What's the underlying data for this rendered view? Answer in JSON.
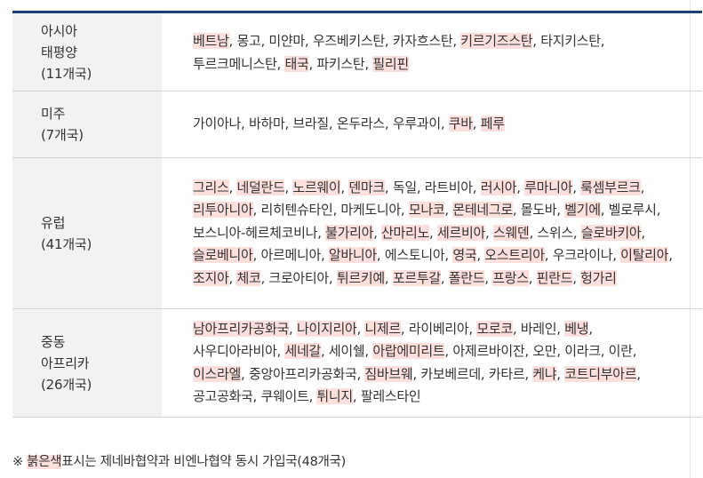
{
  "regions": [
    {
      "name_line1": "아시아",
      "name_line2": "태평양",
      "count": "(11개국)",
      "countries": [
        {
          "name": "베트남",
          "hl": true
        },
        {
          "name": "몽고",
          "hl": false
        },
        {
          "name": "미얀마",
          "hl": false
        },
        {
          "name": "우즈베키스탄",
          "hl": false
        },
        {
          "name": "카자흐스탄",
          "hl": false
        },
        {
          "name": "키르기즈스탄",
          "hl": true
        },
        {
          "name": "타지키스탄",
          "hl": false
        },
        {
          "name": "투르크메니스탄",
          "hl": false
        },
        {
          "name": "태국",
          "hl": true
        },
        {
          "name": "파키스탄",
          "hl": false
        },
        {
          "name": "필리핀",
          "hl": true
        }
      ]
    },
    {
      "name_line1": "미주",
      "name_line2": "",
      "count": "(7개국)",
      "countries": [
        {
          "name": "가이아나",
          "hl": false
        },
        {
          "name": "바하마",
          "hl": false
        },
        {
          "name": "브라질",
          "hl": false
        },
        {
          "name": "온두라스",
          "hl": false
        },
        {
          "name": "우루과이",
          "hl": false
        },
        {
          "name": "쿠바",
          "hl": true
        },
        {
          "name": "페루",
          "hl": true
        }
      ]
    },
    {
      "name_line1": "유럽",
      "name_line2": "",
      "count": "(41개국)",
      "countries": [
        {
          "name": "그리스",
          "hl": true
        },
        {
          "name": "네덜란드",
          "hl": true
        },
        {
          "name": "노르웨이",
          "hl": true
        },
        {
          "name": "덴마크",
          "hl": true
        },
        {
          "name": "독일",
          "hl": false
        },
        {
          "name": "라트비아",
          "hl": false
        },
        {
          "name": "러시아",
          "hl": true
        },
        {
          "name": "루마니아",
          "hl": true
        },
        {
          "name": "룩셈부르크",
          "hl": true
        },
        {
          "name": "리투아니아",
          "hl": true
        },
        {
          "name": "리히텐슈타인",
          "hl": false
        },
        {
          "name": "마케도니아",
          "hl": false
        },
        {
          "name": "모나코",
          "hl": true
        },
        {
          "name": "몬테네그로",
          "hl": true
        },
        {
          "name": "몰도바",
          "hl": false
        },
        {
          "name": "벨기에",
          "hl": true
        },
        {
          "name": "벨로루시",
          "hl": false
        },
        {
          "name": "보스니아-헤르체코비나",
          "hl": false
        },
        {
          "name": "불가리아",
          "hl": true
        },
        {
          "name": "산마리노",
          "hl": true
        },
        {
          "name": "세르비아",
          "hl": true
        },
        {
          "name": "스웨덴",
          "hl": true
        },
        {
          "name": "스위스",
          "hl": false
        },
        {
          "name": "슬로바키아",
          "hl": true
        },
        {
          "name": "슬로베니아",
          "hl": true
        },
        {
          "name": "아르메니아",
          "hl": false
        },
        {
          "name": "알바니아",
          "hl": true
        },
        {
          "name": "에스토니아",
          "hl": false
        },
        {
          "name": "영국",
          "hl": true
        },
        {
          "name": "오스트리아",
          "hl": true
        },
        {
          "name": "우크라이나",
          "hl": false
        },
        {
          "name": "이탈리아",
          "hl": true
        },
        {
          "name": "조지아",
          "hl": true
        },
        {
          "name": "체코",
          "hl": true
        },
        {
          "name": "크로아티아",
          "hl": false
        },
        {
          "name": "튀르키예",
          "hl": true
        },
        {
          "name": "포르투갈",
          "hl": true
        },
        {
          "name": "폴란드",
          "hl": true
        },
        {
          "name": "프랑스",
          "hl": true
        },
        {
          "name": "핀란드",
          "hl": true
        },
        {
          "name": "헝가리",
          "hl": true
        }
      ]
    },
    {
      "name_line1": "중동",
      "name_line2": "아프리카",
      "count": "(26개국)",
      "countries": [
        {
          "name": "남아프리카공화국",
          "hl": true
        },
        {
          "name": "나이지리아",
          "hl": true
        },
        {
          "name": "니제르",
          "hl": true
        },
        {
          "name": "라이베리아",
          "hl": false
        },
        {
          "name": "모로코",
          "hl": true
        },
        {
          "name": "바레인",
          "hl": false
        },
        {
          "name": "베냉",
          "hl": true
        },
        {
          "name": "사우디아라비아",
          "hl": false
        },
        {
          "name": "세네갈",
          "hl": true
        },
        {
          "name": "세이쉘",
          "hl": false
        },
        {
          "name": "아랍에미리트",
          "hl": true
        },
        {
          "name": "아제르바이잔",
          "hl": false
        },
        {
          "name": "오만",
          "hl": false
        },
        {
          "name": "이라크",
          "hl": false
        },
        {
          "name": "이란",
          "hl": false
        },
        {
          "name": "이스라엘",
          "hl": true
        },
        {
          "name": "중앙아프리카공화국",
          "hl": false
        },
        {
          "name": "짐바브웨",
          "hl": true
        },
        {
          "name": "카보베르데",
          "hl": false
        },
        {
          "name": "카타르",
          "hl": false
        },
        {
          "name": "케냐",
          "hl": true
        },
        {
          "name": "코트디부아르",
          "hl": true
        },
        {
          "name": "공고공화국",
          "hl": false
        },
        {
          "name": "쿠웨이트",
          "hl": false
        },
        {
          "name": "튀니지",
          "hl": true
        },
        {
          "name": "팔레스타인",
          "hl": false
        }
      ]
    }
  ],
  "note": {
    "prefix": "※ ",
    "highlight": "붉은색",
    "rest": "표시는 제네바협약과 비엔나협약 동시 가입국(48개국)"
  },
  "colors": {
    "highlight": "#fde0dc",
    "header_rule": "#1d3f7a",
    "region_bg": "#f2f2f2"
  }
}
